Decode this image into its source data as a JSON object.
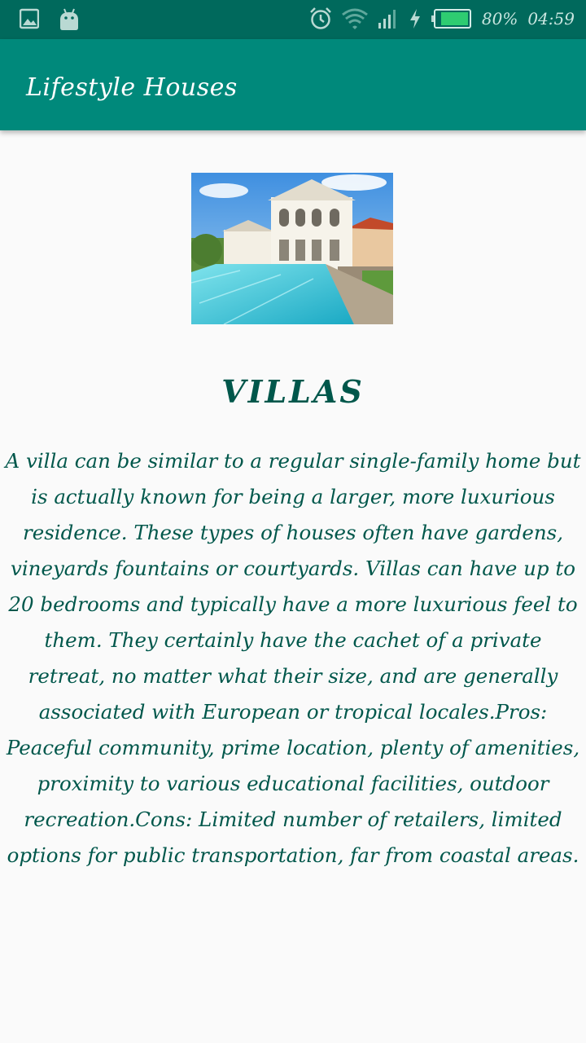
{
  "status_bar": {
    "battery_percent": "80%",
    "time": "04:59",
    "icons": [
      "image-icon",
      "android-icon",
      "alarm-icon",
      "wifi-icon",
      "signal-icon",
      "charging-icon",
      "battery-icon"
    ]
  },
  "app_bar": {
    "title": "Lifestyle Houses"
  },
  "content": {
    "image_subject": "villa-with-pool",
    "heading": "VILLAS",
    "description": "A villa can be similar to a regular single-family home but is actually known for being a larger, more luxurious residence. These types of houses often have gardens, vineyards fountains or courtyards. Villas can have up to 20 bedrooms and typically have a more luxurious feel to them. They certainly have the cachet of a private retreat, no matter what their size, and are generally associated with European or tropical locales.Pros: Peaceful community, prime location, plenty of amenities, proximity to various educational facilities, outdoor recreation.Cons: Limited number of retailers, limited options for public transportation, far from coastal areas."
  },
  "colors": {
    "status_bar": "#00695c",
    "app_bar": "#00897b",
    "text": "#00574b",
    "background": "#fafafa",
    "battery_fill": "#2ecc71"
  }
}
